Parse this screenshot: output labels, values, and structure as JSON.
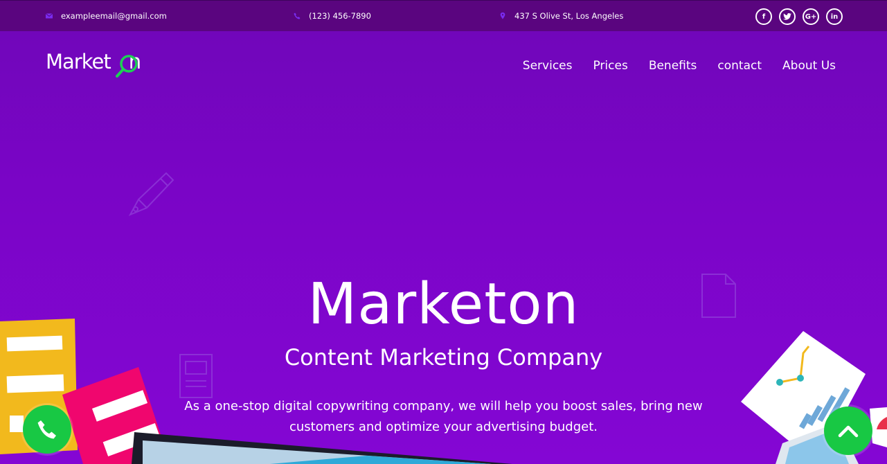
{
  "topbar": {
    "email": "exampleemail@gmail.com",
    "phone": "(123) 456-7890",
    "address": "437 S Olive St, Los Angeles",
    "social": [
      {
        "icon": "facebook-icon",
        "label": "f"
      },
      {
        "icon": "twitter-icon",
        "label": "t"
      },
      {
        "icon": "google-plus-icon",
        "label": "G+"
      },
      {
        "icon": "linkedin-icon",
        "label": "in"
      }
    ]
  },
  "header": {
    "logo_text": "Market",
    "logo_text_end": "n",
    "nav": [
      {
        "label": "Services"
      },
      {
        "label": "Prices"
      },
      {
        "label": "Benefits"
      },
      {
        "label": "contact"
      },
      {
        "label": "About Us"
      }
    ]
  },
  "hero": {
    "title": "Marketon",
    "subtitle": "Content Marketing Company",
    "desc_line1": "As a one-stop digital copywriting company, we will help you boost sales, bring new",
    "desc_line2": "customers and optimize your advertising budget."
  },
  "colors": {
    "background": "#7d05c8",
    "topbar": "#5a057f",
    "accent_green": "#18c844",
    "icon_purple": "#7a2cf0"
  },
  "buttons": {
    "call_icon": "phone-icon",
    "scroll_top_icon": "chevron-up-icon"
  }
}
